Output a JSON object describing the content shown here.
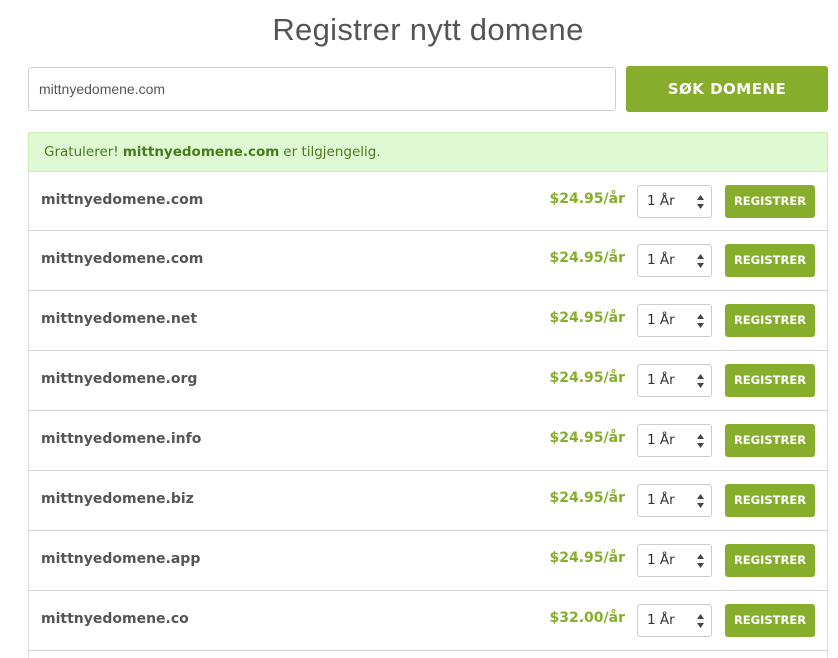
{
  "header": {
    "title": "Registrer nytt domene"
  },
  "search": {
    "value": "mittnyedomene.com",
    "placeholder": "",
    "button_label": "SØK DOMENE"
  },
  "alert": {
    "prefix": "Gratulerer! ",
    "domain": "mittnyedomene.com",
    "suffix": " er tilgjengelig."
  },
  "results": [
    {
      "domain": "mittnyedomene.com",
      "price": "$24.95/år",
      "period": "1 År",
      "button": "REGISTRER"
    },
    {
      "domain": "mittnyedomene.com",
      "price": "$24.95/år",
      "period": "1 År",
      "button": "REGISTRER"
    },
    {
      "domain": "mittnyedomene.net",
      "price": "$24.95/år",
      "period": "1 År",
      "button": "REGISTRER"
    },
    {
      "domain": "mittnyedomene.org",
      "price": "$24.95/år",
      "period": "1 År",
      "button": "REGISTRER"
    },
    {
      "domain": "mittnyedomene.info",
      "price": "$24.95/år",
      "period": "1 År",
      "button": "REGISTRER"
    },
    {
      "domain": "mittnyedomene.biz",
      "price": "$24.95/år",
      "period": "1 År",
      "button": "REGISTRER"
    },
    {
      "domain": "mittnyedomene.app",
      "price": "$24.95/år",
      "period": "1 År",
      "button": "REGISTRER"
    },
    {
      "domain": "mittnyedomene.co",
      "price": "$32.00/år",
      "period": "1 År",
      "button": "REGISTRER"
    }
  ],
  "colors": {
    "accent": "#86ad2b",
    "alert_bg": "#dff9d2",
    "text": "#555555"
  },
  "icons": {
    "select_arrows": "updown-arrows-icon"
  }
}
